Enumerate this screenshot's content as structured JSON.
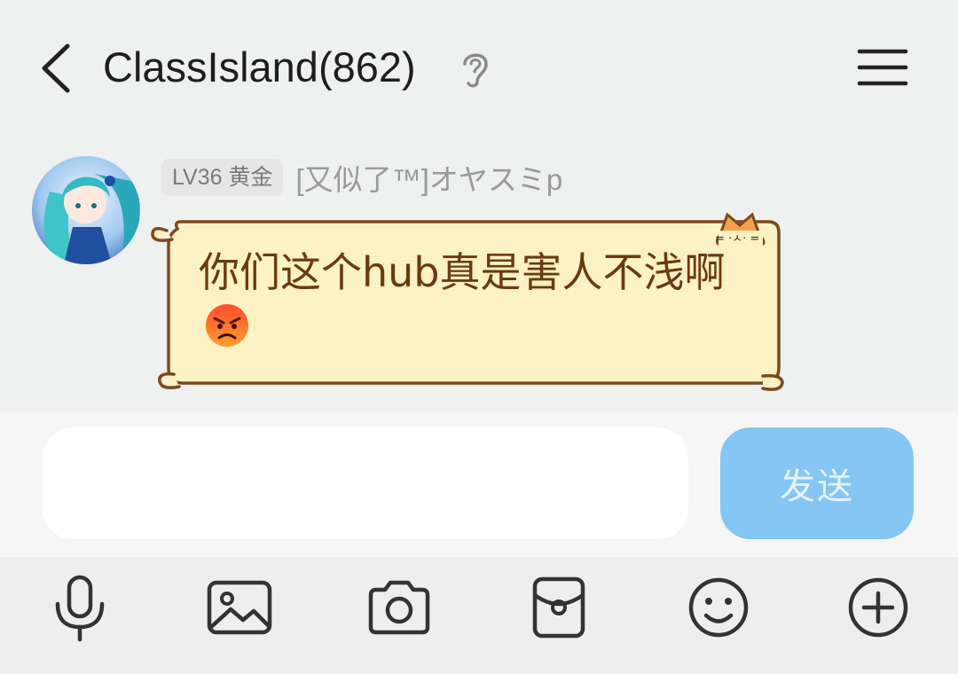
{
  "header": {
    "title": "ClassIsland(862)",
    "icons": [
      "back-arrow-icon",
      "ear-icon",
      "menu-icon"
    ]
  },
  "message": {
    "level_badge": "LV36 黄金",
    "nickname": "[又似了™]オヤスミp",
    "text": "你们这个hub真是害人不浅啊",
    "emoji": "angry-face-emoji",
    "bubble_colors": {
      "fill": "#fdf2c6",
      "border": "#7a4a1e",
      "text": "#6b3a10"
    }
  },
  "composer": {
    "input_value": "",
    "send_label": "发送",
    "send_color": "#85c6f5"
  },
  "toolbar": {
    "items": [
      "microphone-icon",
      "image-icon",
      "camera-icon",
      "red-packet-icon",
      "emoji-icon",
      "plus-icon"
    ]
  }
}
